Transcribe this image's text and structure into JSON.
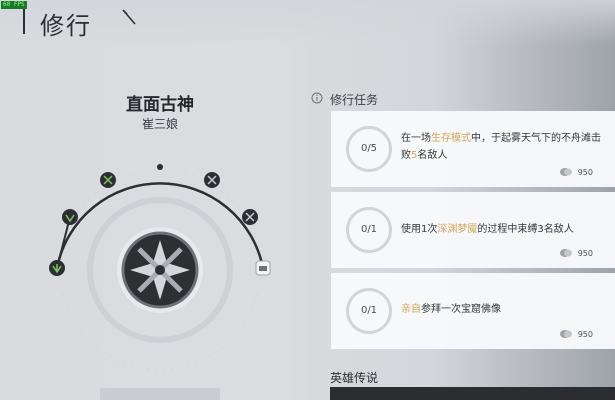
{
  "fps_badge": "60 FPS",
  "header": {
    "title": "修行"
  },
  "character": {
    "name": "直面古神",
    "subtitle": "崔三娘"
  },
  "tasks": {
    "header": "修行任务",
    "items": [
      {
        "progress": "0/5",
        "text_before": "在一场",
        "highlight": "生存模式",
        "text_middle": "中，于起雾天气下的不舟滩击败",
        "highlight2": "5",
        "text_after": "名敌人",
        "reward": "950"
      },
      {
        "progress": "0/1",
        "text_before": "使用1次",
        "highlight": "深渊梦魇",
        "text_after": "的过程中束缚3名敌人",
        "reward": "950"
      },
      {
        "progress": "0/1",
        "text_before": "",
        "highlight": "亲自",
        "text_after": "参拜一次宝窟佛像",
        "reward": "950"
      }
    ]
  },
  "hero_legend": {
    "header": "英雄传说"
  },
  "bottom_tab": {
    "label": ""
  },
  "colors": {
    "highlight": "#d6a55a",
    "node_green": "#7ec45a",
    "arc": "#2b2e33"
  }
}
